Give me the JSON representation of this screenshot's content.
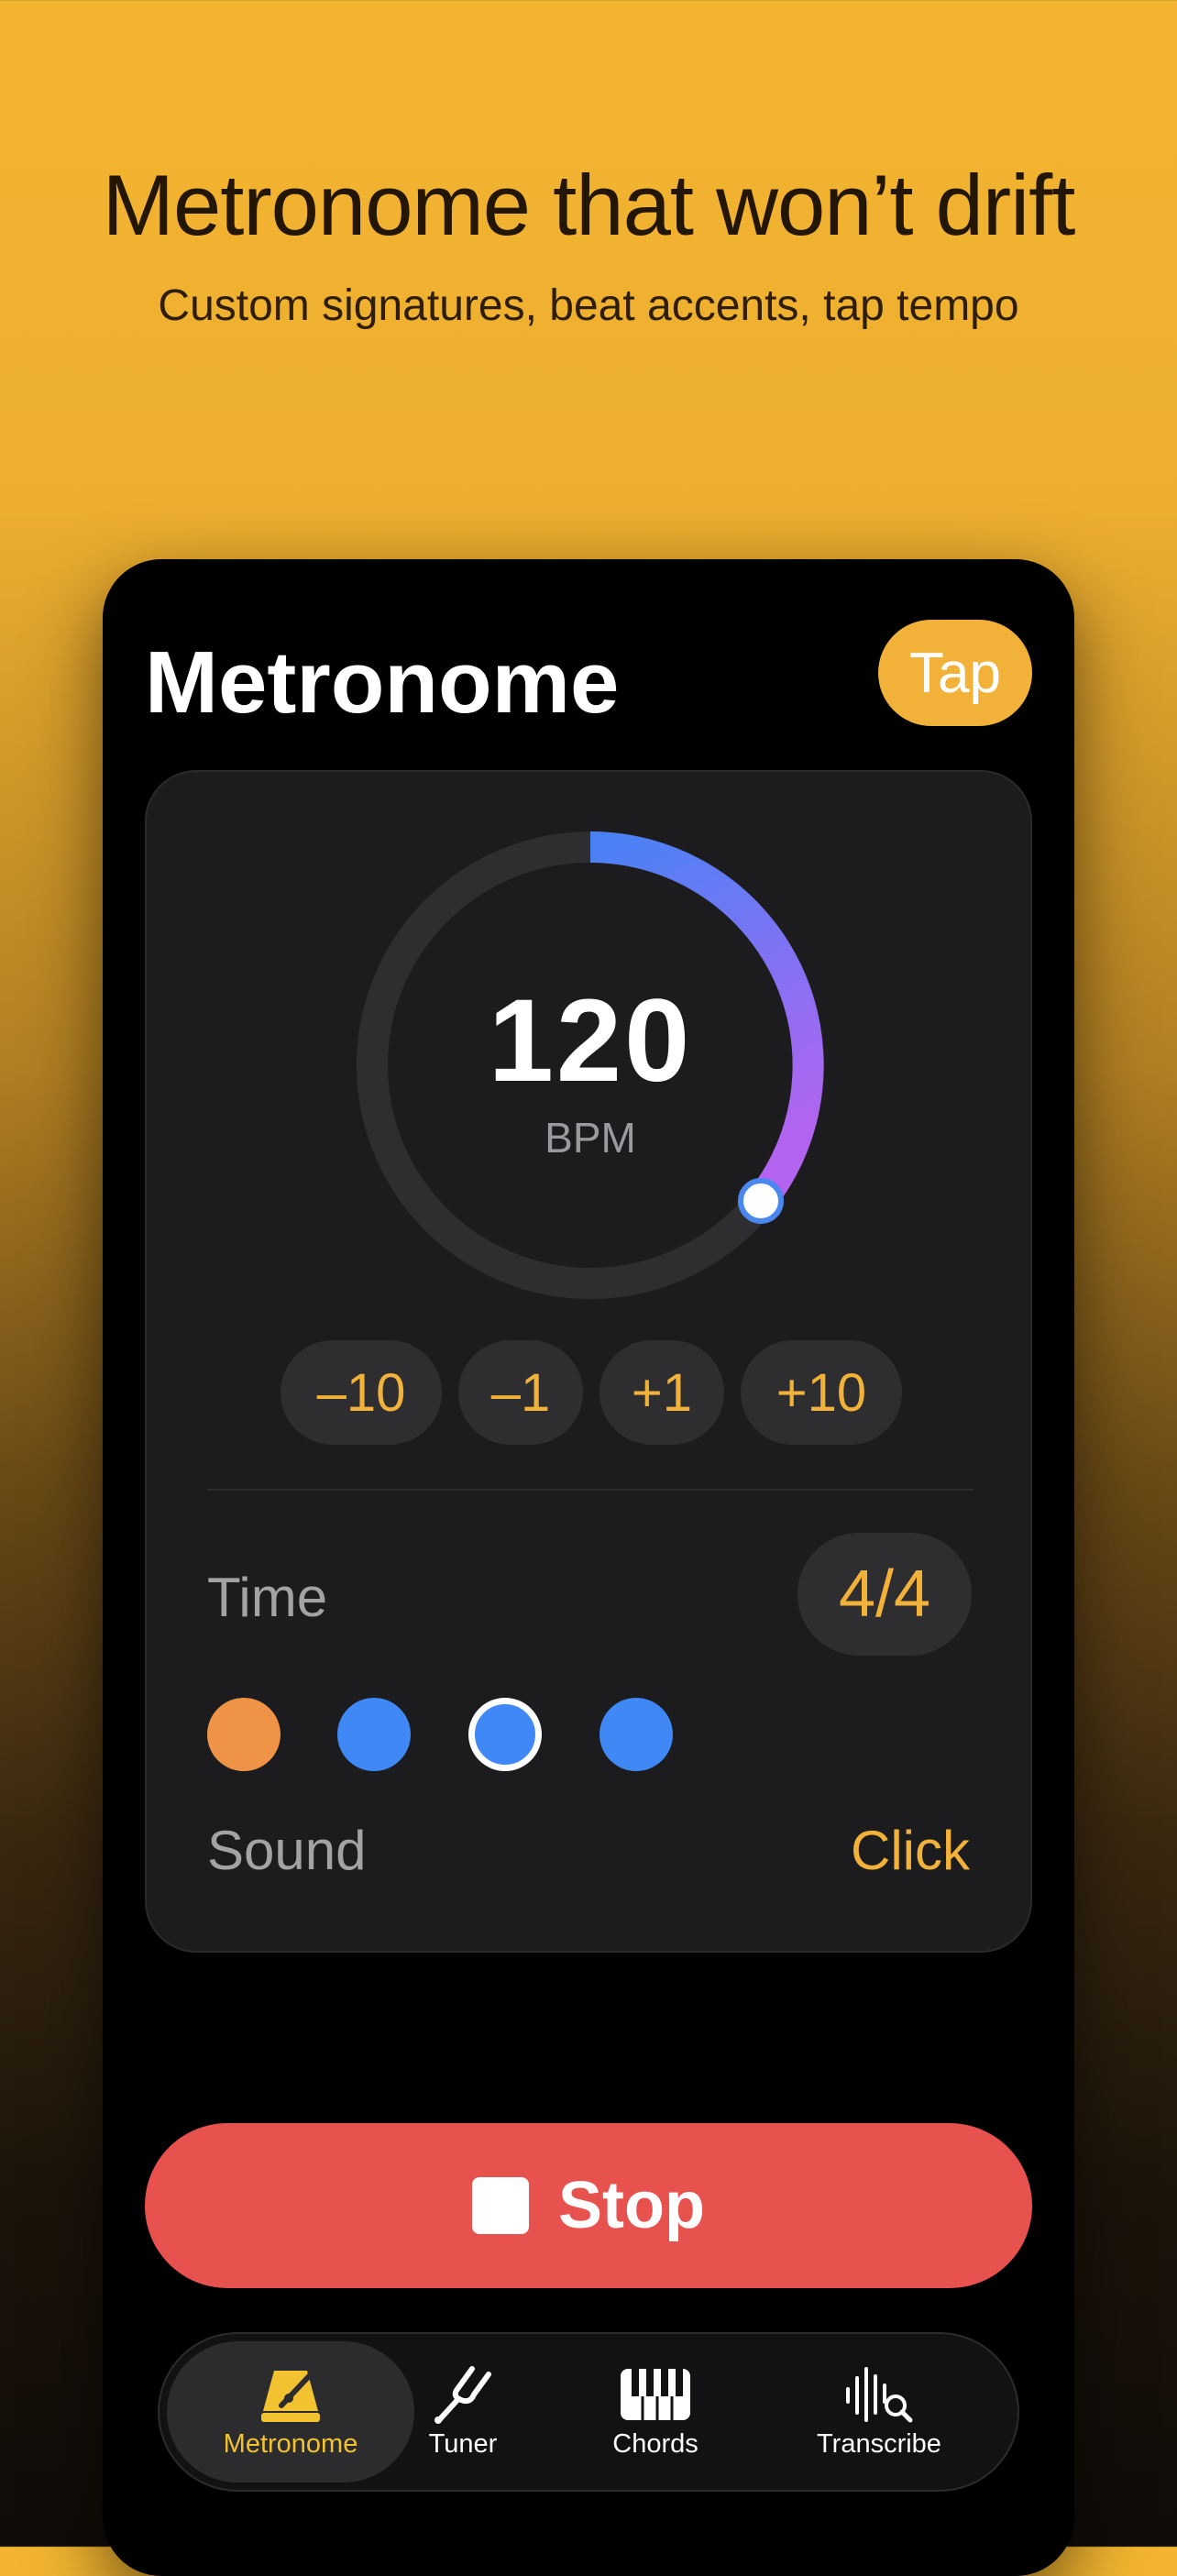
{
  "marketing": {
    "headline": "Metronome that won’t drift",
    "subhead": "Custom signatures, beat accents, tap tempo"
  },
  "app": {
    "title": "Metronome",
    "tap_label": "Tap"
  },
  "tempo": {
    "value": "120",
    "unit": "BPM"
  },
  "steppers": [
    "–10",
    "–1",
    "+1",
    "+10"
  ],
  "time": {
    "label": "Time",
    "signature": "4/4"
  },
  "beats": [
    {
      "state": "accent",
      "color": "#EF9447"
    },
    {
      "state": "normal",
      "color": "#3F88F5"
    },
    {
      "state": "current",
      "color": "#3F88F5"
    },
    {
      "state": "normal",
      "color": "#3F88F5"
    }
  ],
  "sound": {
    "label": "Sound",
    "value": "Click"
  },
  "stop_label": "Stop",
  "tabs": [
    {
      "label": "Metronome",
      "icon": "metronome-icon",
      "active": true
    },
    {
      "label": "Tuner",
      "icon": "tuning-fork-icon",
      "active": false
    },
    {
      "label": "Chords",
      "icon": "piano-keys-icon",
      "active": false
    },
    {
      "label": "Transcribe",
      "icon": "waveform-search-icon",
      "active": false
    }
  ],
  "colors": {
    "accent": "#F2B23A",
    "stop": "#E8524E",
    "arc_start": "#4A82F5",
    "arc_end": "#B264F0"
  }
}
